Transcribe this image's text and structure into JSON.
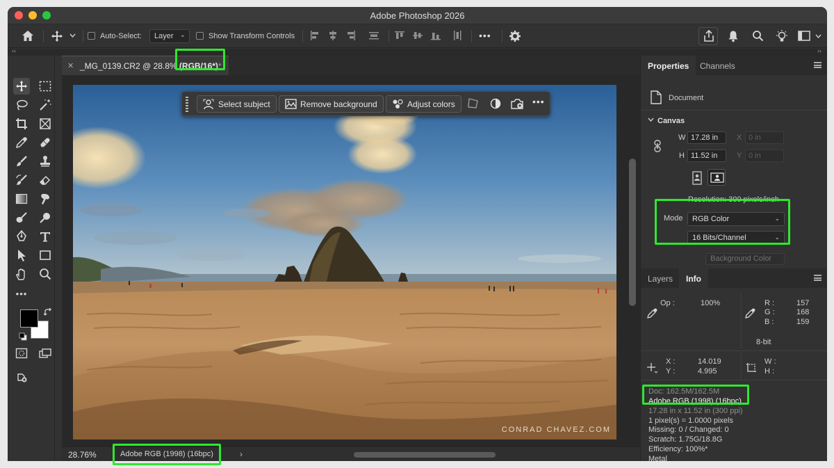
{
  "app": {
    "title": "Adobe Photoshop 2026"
  },
  "options_bar": {
    "auto_select_label": "Auto-Select:",
    "auto_select_value": "Layer",
    "show_transform_label": "Show Transform Controls",
    "more_label": "•••"
  },
  "collapse_strip": {
    "left": "‹‹",
    "right": "››"
  },
  "document": {
    "tab_name": "_MG_0139.CR2 @ 28.8% ",
    "tab_mode": "(RGB/16*)",
    "tab_suffix": "*",
    "zoom": "28.76%",
    "status_profile": "Adobe RGB (1998) (16bpc)",
    "watermark": "CONRAD CHAVEZ.COM"
  },
  "taskbar": {
    "select_subject": "Select subject",
    "remove_background": "Remove background",
    "adjust_colors": "Adjust colors",
    "more": "•••"
  },
  "properties": {
    "tabs": [
      "Properties",
      "Channels"
    ],
    "document_label": "Document",
    "canvas_header": "Canvas",
    "w_label": "W",
    "w_value": "17.28 in",
    "h_label": "H",
    "h_value": "11.52 in",
    "x_label": "X",
    "x_placeholder": "0 in",
    "y_label": "Y",
    "y_placeholder": "0 in",
    "resolution": "Resolution: 300 pixels/inch",
    "mode_label": "Mode",
    "mode_value": "RGB Color",
    "bits_value": "16 Bits/Channel",
    "bg_color": "Background Color"
  },
  "info": {
    "tabs": [
      "Layers",
      "Info"
    ],
    "op_label": "Op :",
    "op_value": "100%",
    "r_label": "R :",
    "r_value": "157",
    "g_label": "G :",
    "g_value": "168",
    "b_label": "B :",
    "b_value": "159",
    "bit_label": "8-bit",
    "x_label": "X :",
    "x_value": "14.019",
    "y_label": "Y :",
    "y_value": "4.995",
    "w_label": "W :",
    "h_label": "H :",
    "doc_line": "Doc: 162.5M/162.5M",
    "profile_line": "Adobe RGB (1998) (16bpc)",
    "dims_line": "17.28 in x 11.52 in (300 ppi)",
    "pixel_line": "1 pixel(s) = 1.0000 pixels",
    "missing_line": "Missing: 0 / Changed: 0",
    "scratch_line": "Scratch: 1.75G/18.8G",
    "efficiency_line": "Efficiency: 100%*",
    "metal_line": "Metal"
  },
  "colors": {
    "highlight": "#2ee82e",
    "foreground": "#000000",
    "background": "#ffffff"
  }
}
